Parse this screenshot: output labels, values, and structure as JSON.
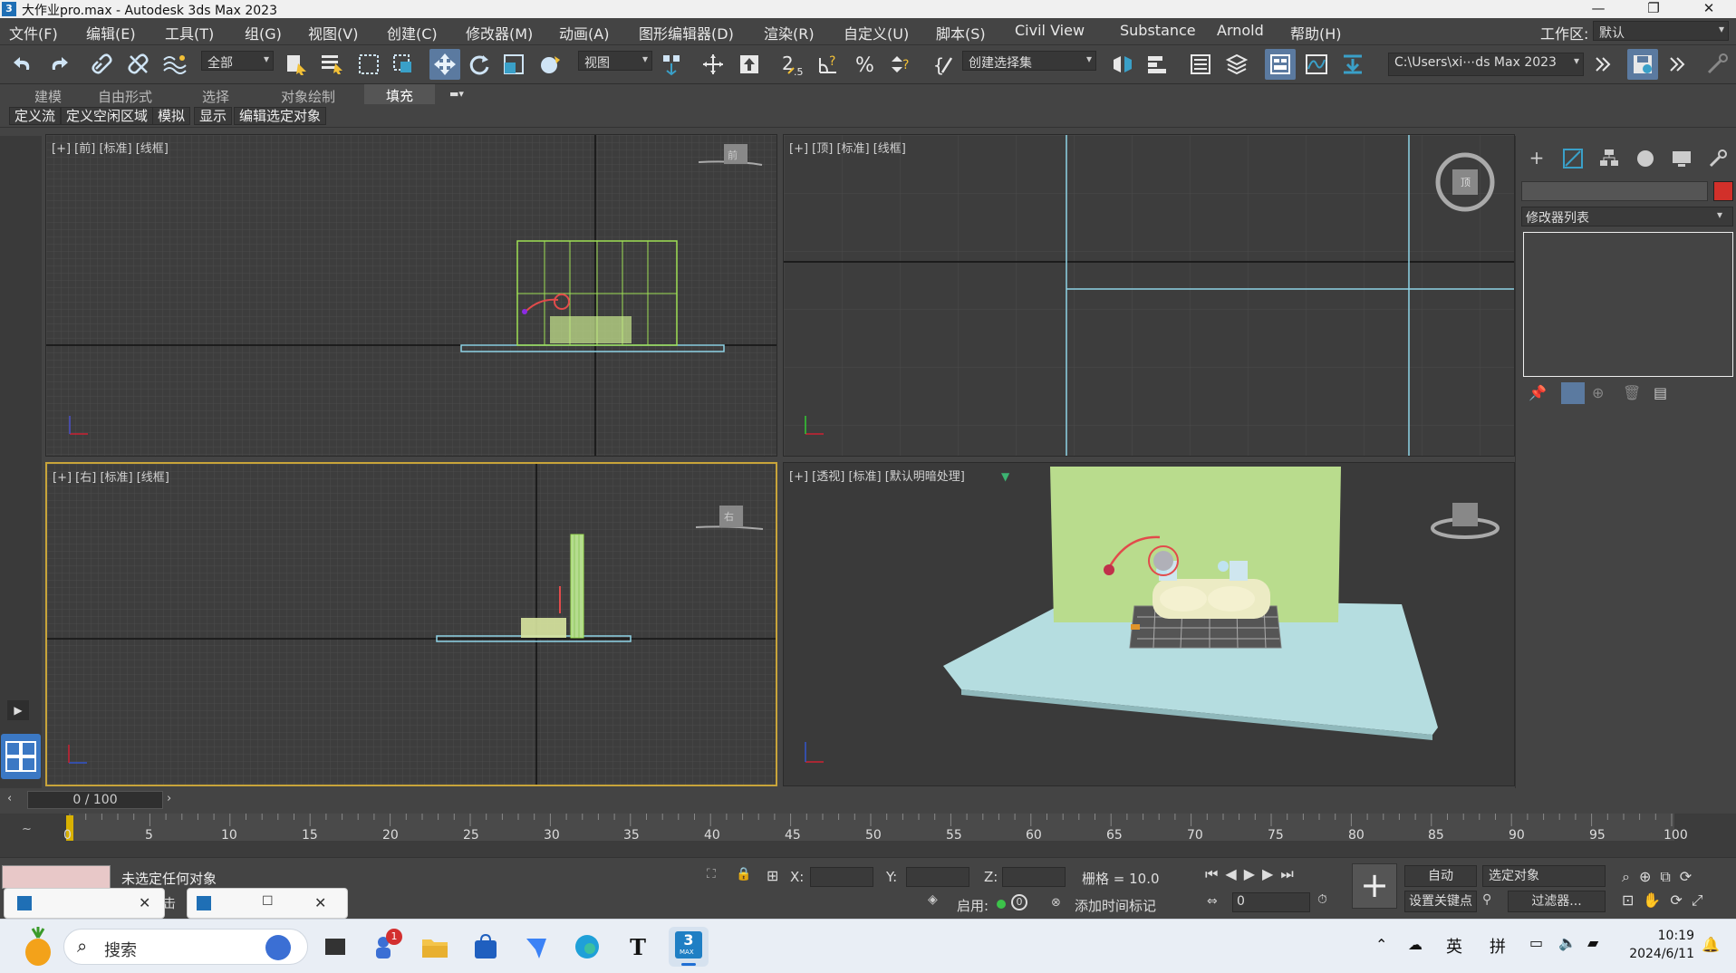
{
  "window": {
    "title": "大作业pro.max - Autodesk 3ds Max 2023",
    "app_icon": "3",
    "minimize": "—",
    "restore": "❐",
    "close": "✕"
  },
  "menu": [
    "文件(F)",
    "编辑(E)",
    "工具(T)",
    "组(G)",
    "视图(V)",
    "创建(C)",
    "修改器(M)",
    "动画(A)",
    "图形编辑器(D)",
    "渲染(R)",
    "自定义(U)",
    "脚本(S)",
    "Civil View",
    "Substance",
    "Arnold",
    "帮助(H)"
  ],
  "workspace": {
    "label": "工作区:",
    "value": "默认"
  },
  "toolbar": {
    "selection_filter": "全部",
    "ref_coord": "视图",
    "named_selection": "创建选择集",
    "project_path": "C:\\Users\\xi⋯ds Max 2023"
  },
  "ribbon_tabs": [
    "建模",
    "自由形式",
    "选择",
    "对象绘制",
    "填充"
  ],
  "ribbon_buttons": [
    "定义流",
    "定义空闲区域",
    "模拟",
    "显示",
    "编辑选定对象"
  ],
  "viewports": {
    "front": "[+] [前] [标准] [线框]",
    "top": "[+] [顶] [标准] [线框]",
    "right": "[+] [右] [标准] [线框]",
    "persp": "[+] [透视] [标准] [默认明暗处理]",
    "front_cube": "前",
    "top_cube": "顶",
    "right_cube": "右"
  },
  "command_panel": {
    "modifier_list": "修改器列表"
  },
  "timeline": {
    "frame": "0 / 100",
    "ticks": [
      "0",
      "5",
      "10",
      "15",
      "20",
      "25",
      "30",
      "35",
      "40",
      "45",
      "50",
      "55",
      "60",
      "65",
      "70",
      "75",
      "80",
      "85",
      "90",
      "95",
      "100"
    ]
  },
  "status": {
    "message": "未选定任何对象",
    "x_label": "X:",
    "y_label": "Y:",
    "z_label": "Z:",
    "grid": "栅格 = 10.0",
    "enable": "启用:",
    "add_time_tag": "添加时间标记",
    "auto": "自动",
    "selected_object": "选定对象",
    "set_key": "设置关键点",
    "filters": "过滤器...",
    "frame_value": "0",
    "hidden_text": "击"
  },
  "taskbar": {
    "search": "搜索",
    "lang1": "英",
    "lang2": "拼",
    "time": "10:19",
    "date": "2024/6/11",
    "badge": "1",
    "text_app": "T",
    "max_app": "3",
    "max_app_sub": "MAX"
  },
  "colors": {
    "accent": "#5b7aa0",
    "active_border": "#c8a43a",
    "wall": "#b5dc8f",
    "floor": "#b5dde0"
  }
}
